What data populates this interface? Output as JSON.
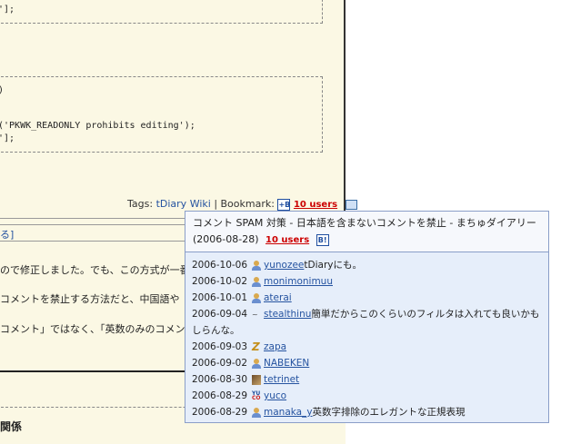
{
  "article": {
    "code1_line": "'];",
    "code2_line1": ")",
    "code2_line2": "('PKWK_READONLY prohibits editing');",
    "code2_line3": "'];",
    "tags_label": "Tags:",
    "tag1": "tDiary",
    "tag2": "Wiki",
    "bookmark_label": "| Bookmark:",
    "users_count": "10 users",
    "bracket_text": "る]",
    "body1": "ので修正しました。でも、この方式が一番",
    "body2": "コメントを禁止する方法だと、中国語や",
    "body3": "コメント」ではなく、「英数のみのコメン",
    "section_title": "関係"
  },
  "popup": {
    "title": "コメント SPAM 対策 - 日本語を含まないコメントを禁止 - まちゅダイアリー (2006-08-28)",
    "users_count": "10 users",
    "hb_icon": "B!",
    "rows": [
      {
        "date": "2006-10-06",
        "user": "yunozee",
        "comment": "tDiaryにも。",
        "avatar": "person-icon"
      },
      {
        "date": "2006-10-02",
        "user": "monimonimuu",
        "comment": "",
        "avatar": "person-icon"
      },
      {
        "date": "2006-10-01",
        "user": "aterai",
        "comment": "",
        "avatar": "person-icon"
      },
      {
        "date": "2006-09-04",
        "user": "stealthinu",
        "comment": "簡単だからこのくらいのフィルタは入れても良いかもしらんな。",
        "avatar": "custom-avatar"
      },
      {
        "date": "2006-09-03",
        "user": "zapa",
        "comment": "",
        "avatar": "z-avatar"
      },
      {
        "date": "2006-09-02",
        "user": "NABEKEN",
        "comment": "",
        "avatar": "person-icon"
      },
      {
        "date": "2006-08-30",
        "user": "tetrinet",
        "comment": "",
        "avatar": "photo-avatar"
      },
      {
        "date": "2006-08-29",
        "user": "yuco",
        "comment": "",
        "avatar": "yuco-avatar"
      },
      {
        "date": "2006-08-29",
        "user": "manaka_y",
        "comment": "英数字排除のエレガントな正規表現",
        "avatar": "person-icon"
      }
    ]
  },
  "colors": {
    "link": "#2553a0",
    "badge": "#cc0000",
    "article_bg": "#fbf8e4",
    "popup_bg": "#e6eefa"
  }
}
